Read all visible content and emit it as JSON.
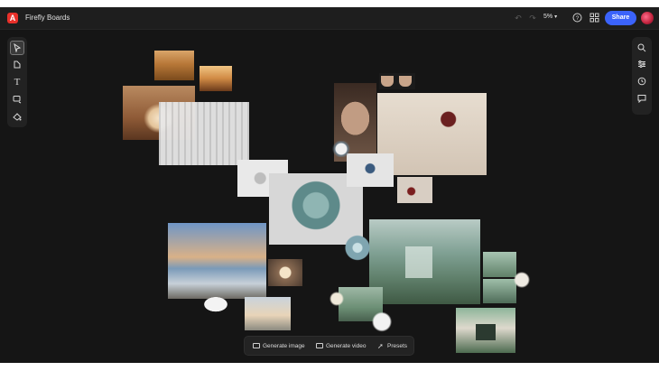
{
  "header": {
    "app_title": "Firefly Boards",
    "logo_glyph": "A",
    "zoom_label": "5%",
    "share_label": "Share",
    "icons": [
      "undo-icon",
      "redo-icon",
      "help-icon",
      "apps-icon"
    ]
  },
  "left_toolbar": {
    "tools": [
      "select-tool",
      "frame-tool",
      "text-tool",
      "shape-tool",
      "fill-tool"
    ]
  },
  "right_toolbar": {
    "tools": [
      "search-icon",
      "adjust-icon",
      "history-icon",
      "comment-icon"
    ]
  },
  "bottom_bar": {
    "generate_image_label": "Generate image",
    "generate_video_label": "Generate video",
    "presets_label": "Presets"
  },
  "colors": {
    "accent": "#3b63fb",
    "logo": "#e9302a",
    "canvas_bg": "#151515"
  }
}
